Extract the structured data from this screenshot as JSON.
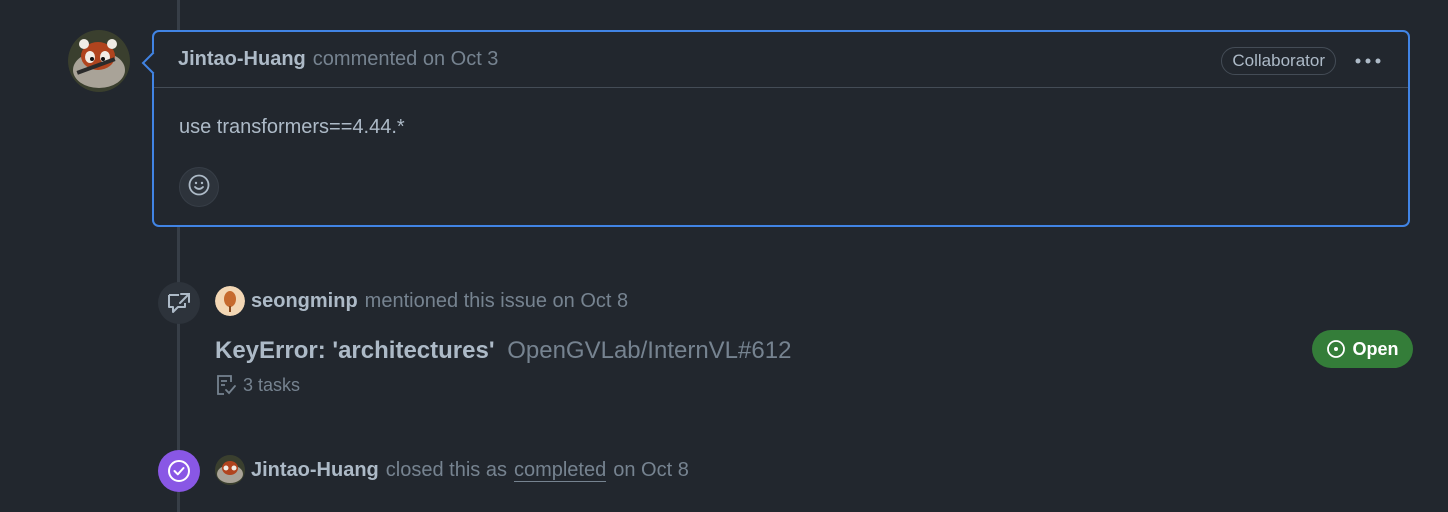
{
  "comment": {
    "author": "Jintao-Huang",
    "action": "commented on Oct 3",
    "role_badge": "Collaborator",
    "body": "use transformers==4.44.*",
    "menu_icon": "kebab-horizontal-icon",
    "reaction_icon": "smiley-icon"
  },
  "cross_reference": {
    "actor": "seongminp",
    "action": "mentioned this issue on Oct 8",
    "issue_title": "KeyError: 'architectures'",
    "issue_ref": "OpenGVLab/InternVL#612",
    "tasks": "3 tasks",
    "state": "Open",
    "icon": "cross-reference-icon",
    "state_color": "#347d39"
  },
  "closed_event": {
    "actor": "Jintao-Huang",
    "action_prefix": "closed this as",
    "reason": "completed",
    "action_suffix": "on Oct 8",
    "icon": "check-circle-icon",
    "icon_color": "#8957e5"
  },
  "colors": {
    "background": "#22272e",
    "accent_border": "#4184e4"
  }
}
